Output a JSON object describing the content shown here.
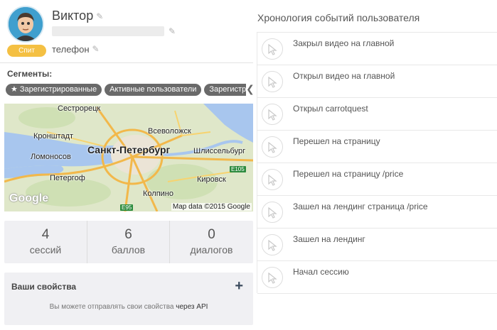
{
  "user": {
    "name": "Виктор",
    "status_badge": "Спит",
    "phone_placeholder": "телефон",
    "avatar_icon": "user-avatar-icon",
    "edit_icon": "pencil-icon"
  },
  "segments": {
    "title": "Сегменты:",
    "items": [
      "Зарегистрированные",
      "Активные пользователи",
      "Зарегистрированные"
    ],
    "scroll_arrow_icon": "chevron-left-icon"
  },
  "map": {
    "labels": [
      "Сестрорецк",
      "Кронштадт",
      "Всеволожск",
      "Санкт-Петербург",
      "Ломоносов",
      "Петергоф",
      "Шлиссельбург",
      "Кировск",
      "Колпино"
    ],
    "road_badges": [
      "E105",
      "E95"
    ],
    "logo": "Google",
    "attribution": "Map data ©2015 Google"
  },
  "stats": [
    {
      "value": "4",
      "label": "сессий"
    },
    {
      "value": "6",
      "label": "баллов"
    },
    {
      "value": "0",
      "label": "диалогов"
    }
  ],
  "properties": {
    "title": "Ваши свойства",
    "add_icon": "plus-icon",
    "text": "Вы можете отправлять свои свойства",
    "link": "через API"
  },
  "timeline": {
    "title": "Хронология событий пользователя",
    "event_icon": "cursor-arrow-icon",
    "events": [
      "Закрыл видео на главной",
      "Открыл видео на главной",
      "Открыл carrotquest",
      "Перешел на страницу",
      "Перешел на страницу /price",
      "Зашел на лендинг страница /price",
      "Зашел на лендинг",
      "Начал сессию"
    ]
  },
  "colors": {
    "badge": "#f4c043",
    "tag": "#6a6a6a",
    "avatar_bg": "#3f9fce",
    "panel_bg": "#f0f0f3"
  }
}
